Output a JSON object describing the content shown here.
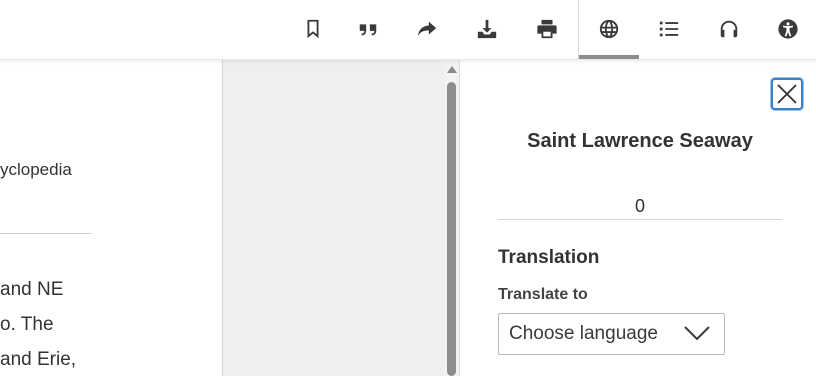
{
  "toolbar": {
    "buttons": [
      {
        "name": "bookmark",
        "icon": "bookmark-icon"
      },
      {
        "name": "cite",
        "icon": "quote-icon"
      },
      {
        "name": "share",
        "icon": "share-arrow-icon"
      },
      {
        "name": "download",
        "icon": "download-icon"
      },
      {
        "name": "print",
        "icon": "printer-icon"
      },
      {
        "name": "translate",
        "icon": "globe-icon",
        "active": true
      },
      {
        "name": "contents",
        "icon": "list-icon"
      },
      {
        "name": "listen",
        "icon": "headphones-icon"
      },
      {
        "name": "accessibility",
        "icon": "accessibility-icon"
      }
    ]
  },
  "article": {
    "source_fragment": "yclopedia",
    "lines": [
      "and NE",
      "o. The",
      " and Erie,"
    ]
  },
  "panel": {
    "title": "Saint Lawrence Seaway",
    "count": "0",
    "section_heading": "Translation",
    "translate_label": "Translate to",
    "language_select_value": "Choose language"
  },
  "colors": {
    "focus_ring": "#3b82c4",
    "active_tab_bar": "#8c8c8c",
    "middle_bg": "#efefef"
  }
}
